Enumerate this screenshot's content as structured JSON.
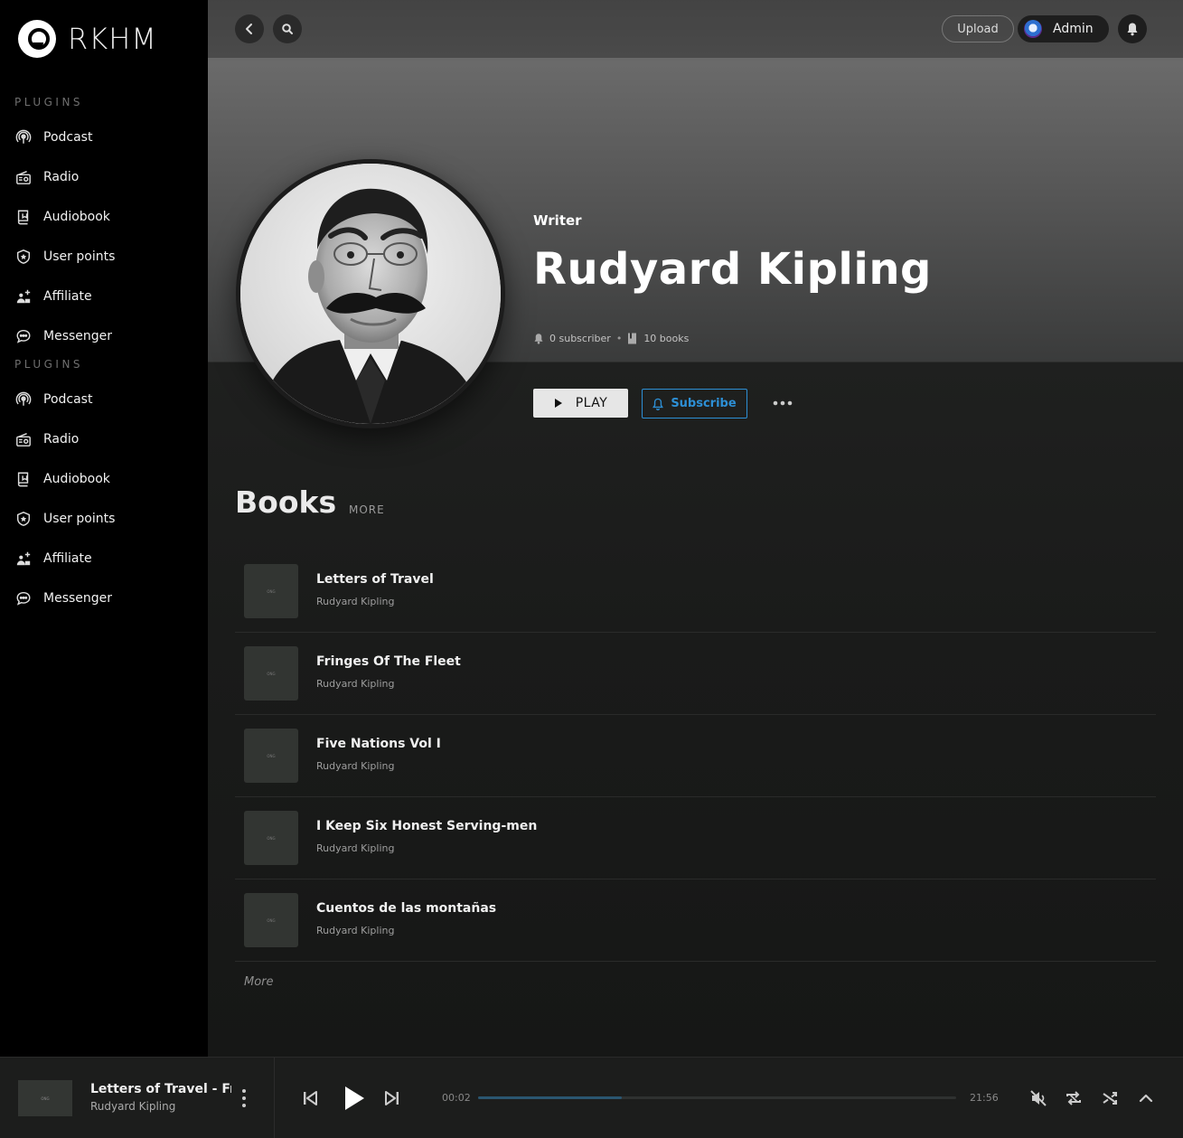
{
  "brand": {
    "name": "RKHM"
  },
  "sidebar": {
    "sections": [
      {
        "title": "PLUGINS",
        "items": [
          {
            "label": "Podcast",
            "icon": "podcast-icon"
          },
          {
            "label": "Radio",
            "icon": "radio-icon"
          },
          {
            "label": "Audiobook",
            "icon": "audiobook-icon"
          },
          {
            "label": "User points",
            "icon": "points-icon"
          },
          {
            "label": "Affiliate",
            "icon": "affiliate-icon"
          },
          {
            "label": "Messenger",
            "icon": "messenger-icon"
          }
        ]
      },
      {
        "title": "PLUGINS",
        "items": [
          {
            "label": "Podcast",
            "icon": "podcast-icon"
          },
          {
            "label": "Radio",
            "icon": "radio-icon"
          },
          {
            "label": "Audiobook",
            "icon": "audiobook-icon"
          },
          {
            "label": "User points",
            "icon": "points-icon"
          },
          {
            "label": "Affiliate",
            "icon": "affiliate-icon"
          },
          {
            "label": "Messenger",
            "icon": "messenger-icon"
          }
        ]
      }
    ]
  },
  "header": {
    "upload_label": "Upload",
    "user_name": "Admin"
  },
  "artist": {
    "role": "Writer",
    "name": "Rudyard Kipling",
    "subscribers": "0 subscriber",
    "books": "10 books",
    "play_label": "PLAY",
    "subscribe_label": "Subscribe"
  },
  "books_section": {
    "title": "Books",
    "more_label": "MORE",
    "list_more_label": "More",
    "thumb_label": "ONG",
    "items": [
      {
        "title": "Letters of Travel",
        "author": "Rudyard Kipling"
      },
      {
        "title": "Fringes Of The Fleet",
        "author": "Rudyard Kipling"
      },
      {
        "title": "Five Nations Vol I",
        "author": "Rudyard Kipling"
      },
      {
        "title": "I Keep Six Honest Serving-men",
        "author": "Rudyard Kipling"
      },
      {
        "title": "Cuentos de las montañas",
        "author": "Rudyard Kipling"
      }
    ]
  },
  "player": {
    "track_title": "Letters of Travel - From",
    "track_artist": "Rudyard Kipling",
    "thumb_label": "ONG",
    "current_time": "00:02",
    "total_time": "21:56",
    "progress_fraction": 0.3
  },
  "colors": {
    "accent": "#2d8fd5",
    "sidebar_bg": "#000000",
    "player_bg": "#1c1d1c"
  }
}
